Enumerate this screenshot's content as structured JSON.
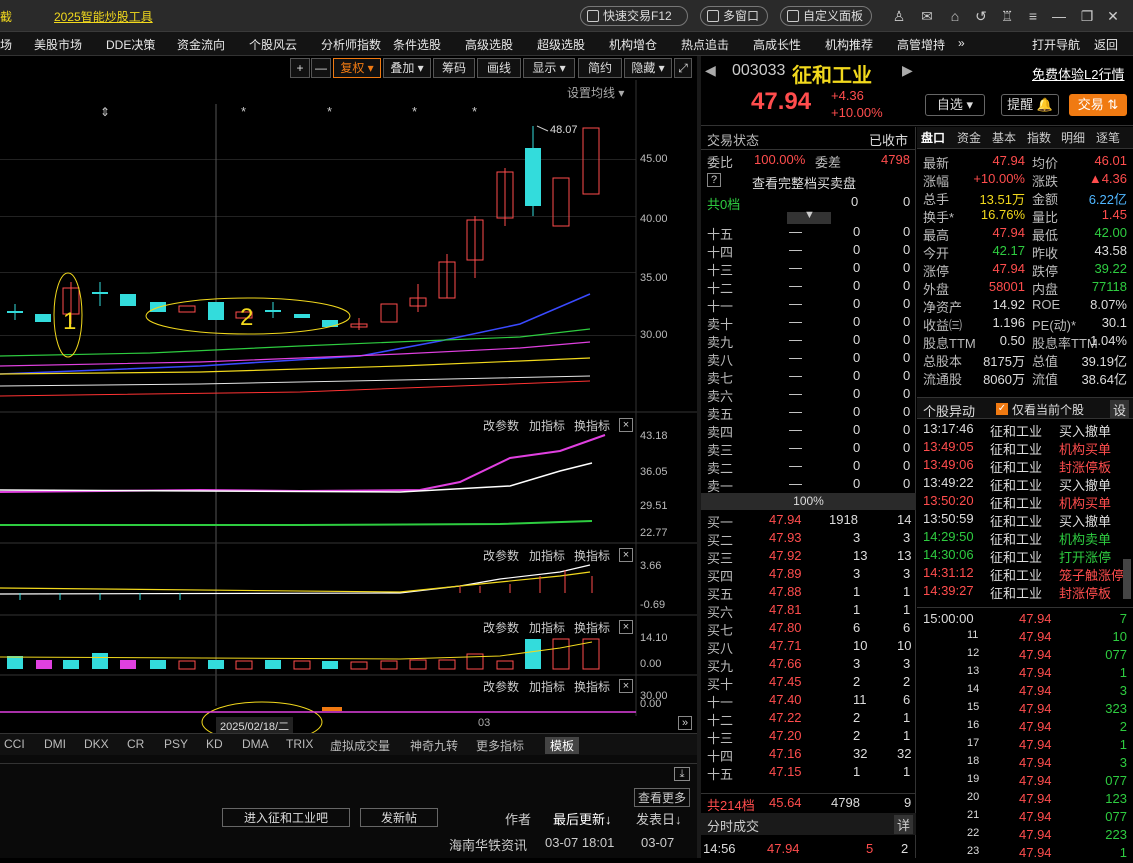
{
  "titlebar": {
    "left_cut": "截",
    "ad": "2025智能炒股工具",
    "quick_trade": "快速交易F12",
    "multi_window": "多窗口",
    "custom_panel": "自定义面板"
  },
  "menu": [
    "场",
    "美股市场",
    "DDE决策",
    "资金流向",
    "个股风云",
    "分析师指数",
    "条件选股",
    "高级选股",
    "超级选股",
    "机构增仓",
    "热点追击",
    "高成长性",
    "机构推荐",
    "高管增持",
    "»",
    "打开导航",
    "返回"
  ],
  "toolbar": {
    "plus": "+",
    "minus": "—",
    "fuquan": "复权",
    "diejia": "叠加",
    "chouma": "筹码",
    "huaxian": "画线",
    "xianshi": "显示",
    "jianyue": "简约",
    "yincang": "隐藏",
    "set_ma": "设置均线"
  },
  "price_axis": [
    "45.00",
    "40.00",
    "35.00",
    "30.00"
  ],
  "max_label": "48.07",
  "annotations": {
    "one": "1",
    "two": "2",
    "date": "2025/02/18/二",
    "month": "03"
  },
  "panel_tools": {
    "params": "改参数",
    "add": "加指标",
    "switch": "换指标",
    "close": "×"
  },
  "ind1_axis": [
    "43.18",
    "36.05",
    "29.51",
    "22.77"
  ],
  "ind2_axis": [
    "3.66",
    "-0.69"
  ],
  "ind3_axis": [
    "14.10",
    "0.00"
  ],
  "ind4_axis": [
    "30.00",
    "0.00"
  ],
  "ind_tabs": [
    "CCI",
    "DMI",
    "DKX",
    "CR",
    "PSY",
    "KD",
    "DMA",
    "TRIX",
    "虚拟成交量",
    "神奇九转",
    "更多指标",
    "模板"
  ],
  "bottom": {
    "enter_bar": "进入征和工业吧",
    "post": "发新帖",
    "author": "作者",
    "last_update": "最后更新↓",
    "post_date": "发表日↓",
    "view_more": "查看更多",
    "source": "海南华铁资讯",
    "time1": "03-07  18:01",
    "date2": "03-07"
  },
  "stock": {
    "code": "003033",
    "name": "征和工业",
    "price": "47.94",
    "change": "+4.36",
    "pct": "+10.00%",
    "l2": "免费体验L2行情",
    "watch": "自选",
    "remind": "提醒",
    "trade": "交易"
  },
  "order": {
    "status_label": "交易状态",
    "status": "已收市",
    "weibi_label": "委比",
    "weibi": "100.00%",
    "weicha_label": "委差",
    "weicha": "4798",
    "full_book": "查看完整档买卖盘",
    "q": "?",
    "total_sell": "共0档",
    "ts_a": "0",
    "ts_b": "0",
    "mid_pct": "100%",
    "total_buy": "共214档",
    "tb_avg": "45.64",
    "tb_vol": "4798",
    "tb_n": "9",
    "fenshi": "分时成交",
    "detail": "详",
    "last_tick": {
      "t": "14:56",
      "p": "47.94",
      "v": "5",
      "n": "2"
    }
  },
  "sell_rows": [
    [
      "十五",
      "—",
      "0",
      "0"
    ],
    [
      "十四",
      "—",
      "0",
      "0"
    ],
    [
      "十三",
      "—",
      "0",
      "0"
    ],
    [
      "十二",
      "—",
      "0",
      "0"
    ],
    [
      "十一",
      "—",
      "0",
      "0"
    ],
    [
      "卖十",
      "—",
      "0",
      "0"
    ],
    [
      "卖九",
      "—",
      "0",
      "0"
    ],
    [
      "卖八",
      "—",
      "0",
      "0"
    ],
    [
      "卖七",
      "—",
      "0",
      "0"
    ],
    [
      "卖六",
      "—",
      "0",
      "0"
    ],
    [
      "卖五",
      "—",
      "0",
      "0"
    ],
    [
      "卖四",
      "—",
      "0",
      "0"
    ],
    [
      "卖三",
      "—",
      "0",
      "0"
    ],
    [
      "卖二",
      "—",
      "0",
      "0"
    ],
    [
      "卖一",
      "—",
      "0",
      "0"
    ]
  ],
  "buy_rows": [
    [
      "买一",
      "47.94",
      "1918",
      "14"
    ],
    [
      "买二",
      "47.93",
      "3",
      "3"
    ],
    [
      "买三",
      "47.92",
      "13",
      "13"
    ],
    [
      "买四",
      "47.89",
      "3",
      "3"
    ],
    [
      "买五",
      "47.88",
      "1",
      "1"
    ],
    [
      "买六",
      "47.81",
      "1",
      "1"
    ],
    [
      "买七",
      "47.80",
      "6",
      "6"
    ],
    [
      "买八",
      "47.71",
      "10",
      "10"
    ],
    [
      "买九",
      "47.66",
      "3",
      "3"
    ],
    [
      "买十",
      "47.45",
      "2",
      "2"
    ],
    [
      "十一",
      "47.40",
      "11",
      "6"
    ],
    [
      "十二",
      "47.22",
      "2",
      "1"
    ],
    [
      "十三",
      "47.20",
      "2",
      "1"
    ],
    [
      "十四",
      "47.16",
      "32",
      "32"
    ],
    [
      "十五",
      "47.15",
      "1",
      "1"
    ]
  ],
  "qtabs": [
    "盘口",
    "资金",
    "基本",
    "指数",
    "明细",
    "逐笔"
  ],
  "quote": [
    [
      "最新",
      "47.94",
      "均价",
      "46.01"
    ],
    [
      "涨幅",
      "+10.00%",
      "涨跌",
      "▲4.36"
    ],
    [
      "总手",
      "13.51万",
      "金额",
      "6.22亿"
    ],
    [
      "换手*",
      "16.76%",
      "量比",
      "1.45"
    ],
    [
      "最高",
      "47.94",
      "最低",
      "42.00"
    ],
    [
      "今开",
      "42.17",
      "昨收",
      "43.58"
    ],
    [
      "涨停",
      "47.94",
      "跌停",
      "39.22"
    ],
    [
      "外盘",
      "58001",
      "内盘",
      "77118"
    ],
    [
      "净资产",
      "14.92",
      "ROE",
      "8.07%"
    ],
    [
      "收益㈢",
      "1.196",
      "PE(动)*",
      "30.1"
    ],
    [
      "股息TTM",
      "0.50",
      "股息率TTM",
      "1.04%"
    ],
    [
      "总股本",
      "8175万",
      "总值",
      "39.19亿"
    ],
    [
      "流通股",
      "8060万",
      "流值",
      "38.64亿"
    ]
  ],
  "anomaly": {
    "title": "个股异动",
    "only": "仅看当前个股",
    "settings": "设",
    "rows": [
      [
        "13:17:46",
        "征和工业",
        "买入撤单"
      ],
      [
        "13:49:05",
        "征和工业",
        "机构买单"
      ],
      [
        "13:49:06",
        "征和工业",
        "封涨停板"
      ],
      [
        "13:49:22",
        "征和工业",
        "买入撤单"
      ],
      [
        "13:50:20",
        "征和工业",
        "机构买单"
      ],
      [
        "13:50:59",
        "征和工业",
        "买入撤单"
      ],
      [
        "14:29:50",
        "征和工业",
        "机构卖单"
      ],
      [
        "14:30:06",
        "征和工业",
        "打开涨停"
      ],
      [
        "14:31:12",
        "征和工业",
        "笼子触涨停"
      ],
      [
        "14:39:27",
        "征和工业",
        "封涨停板"
      ]
    ]
  },
  "ticks": [
    [
      "15:00:00",
      "47.94",
      "7"
    ],
    [
      "11",
      "47.94",
      "10"
    ],
    [
      "12",
      "47.94",
      "077"
    ],
    [
      "13",
      "47.94",
      "1"
    ],
    [
      "14",
      "47.94",
      "3"
    ],
    [
      "15",
      "47.94",
      "323"
    ],
    [
      "16",
      "47.94",
      "2"
    ],
    [
      "17",
      "47.94",
      "1"
    ],
    [
      "18",
      "47.94",
      "3"
    ],
    [
      "19",
      "47.94",
      "077"
    ],
    [
      "20",
      "47.94",
      "123"
    ],
    [
      "21",
      "47.94",
      "077"
    ],
    [
      "22",
      "47.94",
      "223"
    ],
    [
      "23",
      "47.94",
      "1"
    ]
  ],
  "colors": {
    "up": "#ff4d4d",
    "down": "#33dcdc",
    "accent": "#f07a12",
    "bg": "#000000"
  }
}
